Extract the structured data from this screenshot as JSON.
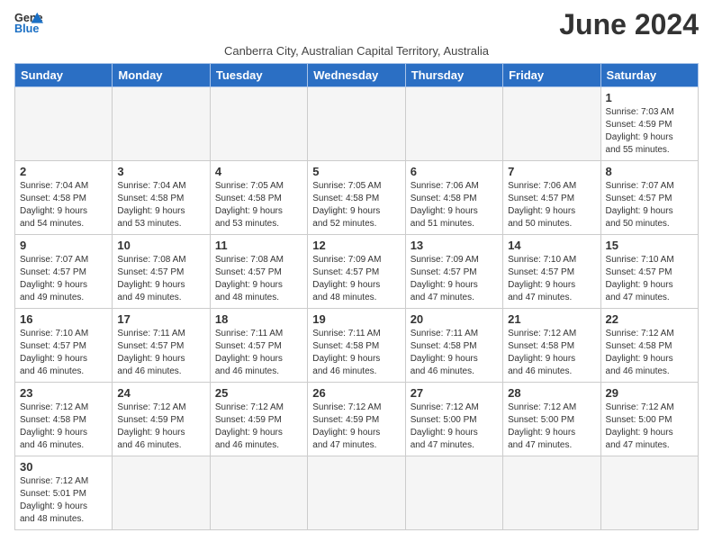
{
  "title": "June 2024",
  "subtitle": "Canberra City, Australian Capital Territory, Australia",
  "logo": {
    "general": "General",
    "blue": "Blue"
  },
  "days_of_week": [
    "Sunday",
    "Monday",
    "Tuesday",
    "Wednesday",
    "Thursday",
    "Friday",
    "Saturday"
  ],
  "weeks": [
    [
      {
        "day": "",
        "info": ""
      },
      {
        "day": "",
        "info": ""
      },
      {
        "day": "",
        "info": ""
      },
      {
        "day": "",
        "info": ""
      },
      {
        "day": "",
        "info": ""
      },
      {
        "day": "",
        "info": ""
      },
      {
        "day": "1",
        "info": "Sunrise: 7:03 AM\nSunset: 4:59 PM\nDaylight: 9 hours\nand 55 minutes."
      }
    ],
    [
      {
        "day": "2",
        "info": "Sunrise: 7:04 AM\nSunset: 4:58 PM\nDaylight: 9 hours\nand 54 minutes."
      },
      {
        "day": "3",
        "info": "Sunrise: 7:04 AM\nSunset: 4:58 PM\nDaylight: 9 hours\nand 53 minutes."
      },
      {
        "day": "4",
        "info": "Sunrise: 7:05 AM\nSunset: 4:58 PM\nDaylight: 9 hours\nand 53 minutes."
      },
      {
        "day": "5",
        "info": "Sunrise: 7:05 AM\nSunset: 4:58 PM\nDaylight: 9 hours\nand 52 minutes."
      },
      {
        "day": "6",
        "info": "Sunrise: 7:06 AM\nSunset: 4:58 PM\nDaylight: 9 hours\nand 51 minutes."
      },
      {
        "day": "7",
        "info": "Sunrise: 7:06 AM\nSunset: 4:57 PM\nDaylight: 9 hours\nand 50 minutes."
      },
      {
        "day": "8",
        "info": "Sunrise: 7:07 AM\nSunset: 4:57 PM\nDaylight: 9 hours\nand 50 minutes."
      }
    ],
    [
      {
        "day": "9",
        "info": "Sunrise: 7:07 AM\nSunset: 4:57 PM\nDaylight: 9 hours\nand 49 minutes."
      },
      {
        "day": "10",
        "info": "Sunrise: 7:08 AM\nSunset: 4:57 PM\nDaylight: 9 hours\nand 49 minutes."
      },
      {
        "day": "11",
        "info": "Sunrise: 7:08 AM\nSunset: 4:57 PM\nDaylight: 9 hours\nand 48 minutes."
      },
      {
        "day": "12",
        "info": "Sunrise: 7:09 AM\nSunset: 4:57 PM\nDaylight: 9 hours\nand 48 minutes."
      },
      {
        "day": "13",
        "info": "Sunrise: 7:09 AM\nSunset: 4:57 PM\nDaylight: 9 hours\nand 47 minutes."
      },
      {
        "day": "14",
        "info": "Sunrise: 7:10 AM\nSunset: 4:57 PM\nDaylight: 9 hours\nand 47 minutes."
      },
      {
        "day": "15",
        "info": "Sunrise: 7:10 AM\nSunset: 4:57 PM\nDaylight: 9 hours\nand 47 minutes."
      }
    ],
    [
      {
        "day": "16",
        "info": "Sunrise: 7:10 AM\nSunset: 4:57 PM\nDaylight: 9 hours\nand 46 minutes."
      },
      {
        "day": "17",
        "info": "Sunrise: 7:11 AM\nSunset: 4:57 PM\nDaylight: 9 hours\nand 46 minutes."
      },
      {
        "day": "18",
        "info": "Sunrise: 7:11 AM\nSunset: 4:57 PM\nDaylight: 9 hours\nand 46 minutes."
      },
      {
        "day": "19",
        "info": "Sunrise: 7:11 AM\nSunset: 4:58 PM\nDaylight: 9 hours\nand 46 minutes."
      },
      {
        "day": "20",
        "info": "Sunrise: 7:11 AM\nSunset: 4:58 PM\nDaylight: 9 hours\nand 46 minutes."
      },
      {
        "day": "21",
        "info": "Sunrise: 7:12 AM\nSunset: 4:58 PM\nDaylight: 9 hours\nand 46 minutes."
      },
      {
        "day": "22",
        "info": "Sunrise: 7:12 AM\nSunset: 4:58 PM\nDaylight: 9 hours\nand 46 minutes."
      }
    ],
    [
      {
        "day": "23",
        "info": "Sunrise: 7:12 AM\nSunset: 4:58 PM\nDaylight: 9 hours\nand 46 minutes."
      },
      {
        "day": "24",
        "info": "Sunrise: 7:12 AM\nSunset: 4:59 PM\nDaylight: 9 hours\nand 46 minutes."
      },
      {
        "day": "25",
        "info": "Sunrise: 7:12 AM\nSunset: 4:59 PM\nDaylight: 9 hours\nand 46 minutes."
      },
      {
        "day": "26",
        "info": "Sunrise: 7:12 AM\nSunset: 4:59 PM\nDaylight: 9 hours\nand 47 minutes."
      },
      {
        "day": "27",
        "info": "Sunrise: 7:12 AM\nSunset: 5:00 PM\nDaylight: 9 hours\nand 47 minutes."
      },
      {
        "day": "28",
        "info": "Sunrise: 7:12 AM\nSunset: 5:00 PM\nDaylight: 9 hours\nand 47 minutes."
      },
      {
        "day": "29",
        "info": "Sunrise: 7:12 AM\nSunset: 5:00 PM\nDaylight: 9 hours\nand 47 minutes."
      }
    ],
    [
      {
        "day": "30",
        "info": "Sunrise: 7:12 AM\nSunset: 5:01 PM\nDaylight: 9 hours\nand 48 minutes."
      },
      {
        "day": "",
        "info": ""
      },
      {
        "day": "",
        "info": ""
      },
      {
        "day": "",
        "info": ""
      },
      {
        "day": "",
        "info": ""
      },
      {
        "day": "",
        "info": ""
      },
      {
        "day": "",
        "info": ""
      }
    ]
  ]
}
